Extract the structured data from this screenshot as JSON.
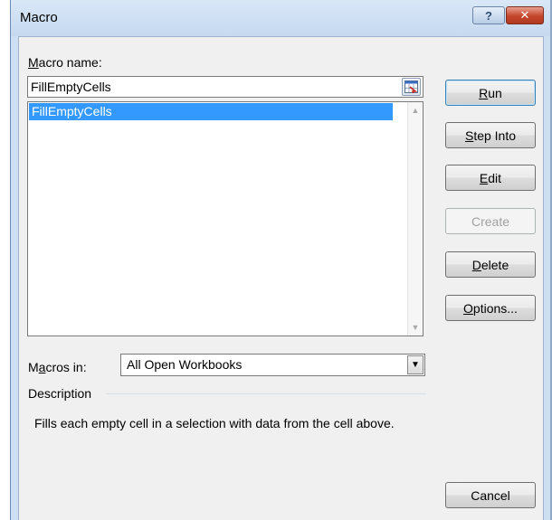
{
  "dialog": {
    "title": "Macro",
    "help_glyph": "?",
    "close_glyph": "✕"
  },
  "macro_name": {
    "label_underlined": "M",
    "label_rest": "acro name:",
    "value": "FillEmptyCells"
  },
  "macro_list": {
    "items": [
      "FillEmptyCells"
    ],
    "selected": 0
  },
  "buttons": {
    "run": {
      "u": "R",
      "rest": "un"
    },
    "step_into": {
      "u": "S",
      "rest": "tep Into"
    },
    "edit": {
      "u": "E",
      "rest": "dit"
    },
    "create": {
      "label": "Create"
    },
    "delete": {
      "u": "D",
      "rest": "elete"
    },
    "options": {
      "u": "O",
      "rest": "ptions..."
    },
    "cancel": {
      "label": "Cancel"
    }
  },
  "macros_in": {
    "label_pre": "M",
    "label_underlined": "a",
    "label_rest": "cros in:",
    "value": "All Open Workbooks"
  },
  "description": {
    "heading": "Description",
    "text": "Fills each empty cell in a selection with data from the cell above."
  }
}
